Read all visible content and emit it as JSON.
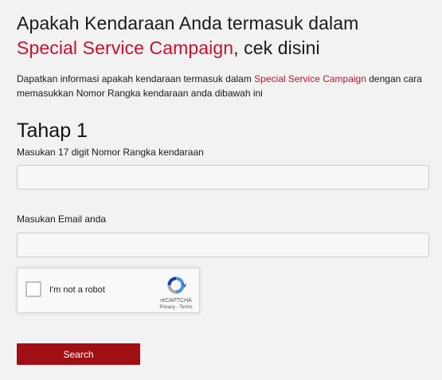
{
  "header": {
    "title_part1": "Apakah Kendaraan Anda termasuk dalam",
    "title_highlight": "Special Service Campaign",
    "title_part2": ", cek disini"
  },
  "intro": {
    "text_part1": "Dapatkan informasi apakah kendaraan termasuk dalam ",
    "text_highlight": "Special Service Campaign",
    "text_part2": " dengan cara memasukkan Nomor Rangka kendaraan anda dibawah ini"
  },
  "step": {
    "title": "Tahap 1"
  },
  "form": {
    "vin_label": "Masukan 17 digit Nomor Rangka kendaraan",
    "vin_value": "",
    "vin_placeholder": "",
    "email_label": "Masukan Email anda",
    "email_value": "",
    "email_placeholder": "",
    "search_label": "Search"
  },
  "recaptcha": {
    "label": "I'm not a robot",
    "brand": "reCAPTCHA",
    "privacy": "Privacy",
    "separator": " - ",
    "terms": "Terms",
    "checked": false,
    "icon": "recaptcha-logo-icon"
  },
  "colors": {
    "accent_red": "#c8102e",
    "button_red": "#a00f13",
    "background": "#f2f2f2"
  }
}
